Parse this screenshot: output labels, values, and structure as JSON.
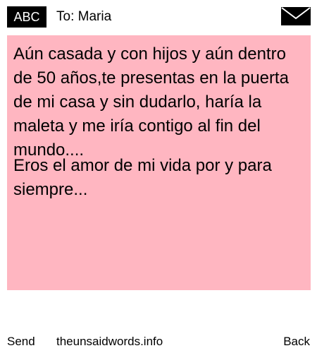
{
  "header": {
    "mode_label": "ABC",
    "recipient": "To: Maria",
    "envelope_icon": "envelope-icon"
  },
  "note": {
    "background_color": "#ffb6c1",
    "paragraphs": [
      "Aún casada y con hijos y aún dentro de 50 años,te presentas en la puerta de mi casa y sin dudarlo, haría la maleta y me iría contigo al fin del mundo....",
      "Eros el amor de mi vida por y para siempre..."
    ]
  },
  "footer": {
    "send_label": "Send",
    "site_label": "theunsaidwords.info",
    "back_label": "Back"
  }
}
